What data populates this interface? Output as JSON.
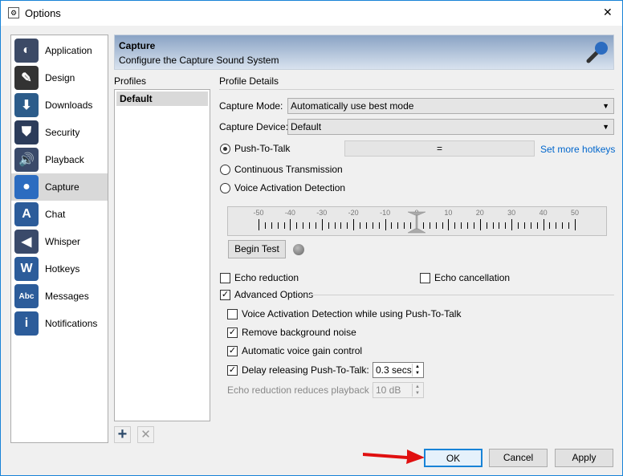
{
  "window": {
    "title": "Options",
    "close": "✕"
  },
  "sidebar": {
    "items": [
      {
        "label": "Application",
        "icon": "teamtalk-icon",
        "color": "#3c4a66"
      },
      {
        "label": "Design",
        "icon": "pencil-icon",
        "color": "#333"
      },
      {
        "label": "Downloads",
        "icon": "download-icon",
        "color": "#2c5c8a"
      },
      {
        "label": "Security",
        "icon": "shield-icon",
        "color": "#2c3c5a"
      },
      {
        "label": "Playback",
        "icon": "speaker-icon",
        "color": "#3a4a6a"
      },
      {
        "label": "Capture",
        "icon": "microphone-icon",
        "color": "#2c6cc0"
      },
      {
        "label": "Chat",
        "icon": "chat-icon",
        "color": "#2c5c9a"
      },
      {
        "label": "Whisper",
        "icon": "speaker-low-icon",
        "color": "#3a4a6a"
      },
      {
        "label": "Hotkeys",
        "icon": "keyboard-icon",
        "color": "#2c5c9a"
      },
      {
        "label": "Messages",
        "icon": "abc-icon",
        "color": "#2c5c9a"
      },
      {
        "label": "Notifications",
        "icon": "info-icon",
        "color": "#2c5c9a"
      }
    ],
    "selected": "Capture"
  },
  "header": {
    "title": "Capture",
    "subtitle": "Configure the Capture Sound System"
  },
  "profiles": {
    "label": "Profiles",
    "items": [
      "Default"
    ],
    "add": "+",
    "remove": "✕"
  },
  "details": {
    "label": "Profile Details",
    "capture_mode_label": "Capture Mode:",
    "capture_mode": "Automatically use best mode",
    "capture_device_label": "Capture Device:",
    "capture_device": "Default",
    "ptt": "Push-To-Talk",
    "hotkey": "=",
    "set_hotkeys": "Set more hotkeys",
    "continuous": "Continuous Transmission",
    "vad": "Voice Activation Detection",
    "mode_selected": "Push-To-Talk",
    "meter": {
      "ticks": [
        -50,
        -40,
        -30,
        -20,
        -10,
        0,
        10,
        20,
        30,
        40,
        50
      ],
      "min": -50,
      "max": 50,
      "value": 0
    },
    "begin_test": "Begin Test",
    "echo_reduction": "Echo reduction",
    "echo_reduction_checked": false,
    "echo_cancellation": "Echo cancellation",
    "echo_cancellation_checked": false,
    "advanced": "Advanced Options",
    "advanced_checked": true,
    "vad_ptt": "Voice Activation Detection while using Push-To-Talk",
    "vad_ptt_checked": false,
    "noise": "Remove background noise",
    "noise_checked": true,
    "agc": "Automatic voice gain control",
    "agc_checked": true,
    "delay": "Delay releasing Push-To-Talk:",
    "delay_checked": true,
    "delay_value": "0.3 secs",
    "echo_playback": "Echo reduction reduces playback by:",
    "echo_playback_value": "10 dB"
  },
  "buttons": {
    "ok": "OK",
    "cancel": "Cancel",
    "apply": "Apply"
  },
  "colors": {
    "accent": "#1883d7",
    "arrow": "#e01010"
  }
}
